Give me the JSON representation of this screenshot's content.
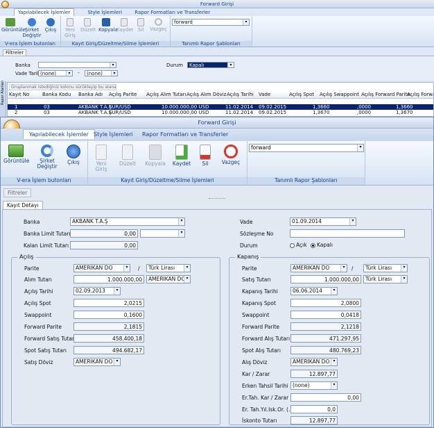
{
  "back": {
    "title": "Forward Girişi",
    "tabs": [
      "Yapılabilecek İşlemler",
      "Style İşlemleri",
      "Rapor Formatları ve Transferler"
    ],
    "buttons": [
      "Görüntüle",
      "Şirket Değiştir",
      "Çıkış",
      "Yeni Giriş",
      "Düzelt",
      "Kopyala",
      "Kaydet",
      "Sil",
      "Vazgeç"
    ],
    "groups": [
      "V-era İşlem butonları",
      "Kayıt Giriş/Düzeltme/Silme İşlemleri",
      "Tanımlı Rapor Şablonları"
    ],
    "template": "forward",
    "filter_tab": "Filtreler",
    "banka_label": "Banka",
    "durum_label": "Durum",
    "durum_value": "Kapalı",
    "vade_label": "Vade Tarihi",
    "none1": "(none)",
    "none2": "(none)",
    "dash": "-",
    "group_hint": "Gruplanmak istediğiniz kolonu sürükleyip bu alana bırakınız",
    "side_label": "Rapor Alanları",
    "columns": [
      "Kayıt No",
      "Banka Kodu",
      "Banka Adı",
      "Açılış Parite",
      "Açılış Alım Tutarı",
      "Açılış Alım Döviz",
      "Açılış Tarihi",
      "Vade",
      "Açılış Spot",
      "Açılış Swappoint",
      "Açılış Forward Parite",
      "Açılış Forwa..."
    ],
    "rows": [
      [
        "1",
        "03",
        "AKBANK T.A.Ş",
        "EUR/USD",
        "10.000.000,00 USD",
        "11.02.2014",
        "09.02.2015",
        "1,3660",
        ",0000",
        "1,3660"
      ],
      [
        "2",
        "03",
        "AKBANK T.A.Ş",
        "EUR/USD",
        "10.000.000,00 USD",
        "11.02.2014",
        "09.02.2015",
        "1,3670",
        ",0000",
        "1,3670"
      ]
    ]
  },
  "front": {
    "title": "Forward Girişi",
    "tabs": [
      "Yapılabilecek İşlemler",
      "Style İşlemleri",
      "Rapor Formatları ve Transferler"
    ],
    "buttons": {
      "view": "Görüntüle",
      "switch": "Şirket Değiştir",
      "exit": "Çıkış",
      "new": "Yeni Giriş",
      "edit": "Düzelt",
      "copy": "Kopyala",
      "save": "Kaydet",
      "delete": "Sil",
      "cancel": "Vazgeç"
    },
    "groups": {
      "vera": "V-era İşlem butonları",
      "record": "Kayıt Giriş/Düzeltme/Silme İşlemleri",
      "templates": "Tanımlı Rapor Şablonları"
    },
    "template": "forward",
    "filter_tab": "Filtreler",
    "detail_tab": "Kayıt Detayı",
    "banka": {
      "label": "Banka",
      "value": "AKBANK T.A.Ş"
    },
    "banka_limit": {
      "label": "Banka Limit Tutarı",
      "value": "0,00"
    },
    "kalan_limit": {
      "label": "Kalan Limit Tutarı",
      "value": "0,00"
    },
    "vade": {
      "label": "Vade",
      "value": "01.09.2014"
    },
    "sozlesme": {
      "label": "Sözleşme No",
      "value": ""
    },
    "durum": {
      "label": "Durum",
      "open": "Açık",
      "closed": "Kapalı"
    },
    "acilis": {
      "legend": "Açılış",
      "parite_label": "Parite",
      "parite1": "AMERIKAN DO",
      "slash": "/",
      "parite2": "Türk Lirası",
      "alim_label": "Alım Tutarı",
      "alim_value": "1.000.000,00",
      "alim_cur": "AMERIKAN DO",
      "tarih_label": "Açılış Tarihi",
      "tarih_value": "02.09.2013",
      "spot_label": "Açılış Spot",
      "spot_value": "2,0215",
      "swap_label": "Swappoint",
      "swap_value": "0,1600",
      "fwd_label": "Forward Parite",
      "fwd_value": "2,1815",
      "fwd_satis_label": "Forward Satış Tutarı",
      "fwd_satis_value": "458.400,18",
      "spot_satis_label": "Spot Satış Tutarı",
      "spot_satis_value": "494.682,17",
      "doviz_label": "Satış Döviz",
      "doviz_value": "AMERIKAN DO"
    },
    "kapanis": {
      "legend": "Kapanış",
      "parite_label": "Parite",
      "parite1": "AMERIKAN DO",
      "slash": "/",
      "parite2": "Türk Lirası",
      "satis_label": "Satış Tutarı",
      "satis_value": "1.000.000,00",
      "satis_cur": "Türk Lirası",
      "tarih_label": "Kapanış Tarihi",
      "tarih_value": "06.06.2014",
      "spot_label": "Kapanış Spot",
      "spot_value": "2,0800",
      "swap_label": "Swappoint",
      "swap_value": "0,0418",
      "fwd_label": "Forward Parite",
      "fwd_value": "2,1218",
      "fwd_alis_label": "Forward Alış Tutarı",
      "fwd_alis_value": "471.297,95",
      "spot_alis_label": "Spot Alış Tutarı",
      "spot_alis_value": "480.769,23",
      "doviz_label": "Alış Döviz",
      "doviz_value": "AMERIKAN DO",
      "kar_label": "Kar / Zarar",
      "kar_value": "12.897,77",
      "erken_label": "Erken Tahsil Tarihi",
      "erken_value": "(none)",
      "ertah_label": "Er.Tah. Kar / Zarar",
      "ertah_value": "0,00",
      "ertahyil_label": "Er. Tah.Yıl.Isk.Or. (...",
      "ertahyil_value": "0,0",
      "iskonto_label": "İskonto Tutarı",
      "iskonto_value": "12.897,77"
    }
  }
}
